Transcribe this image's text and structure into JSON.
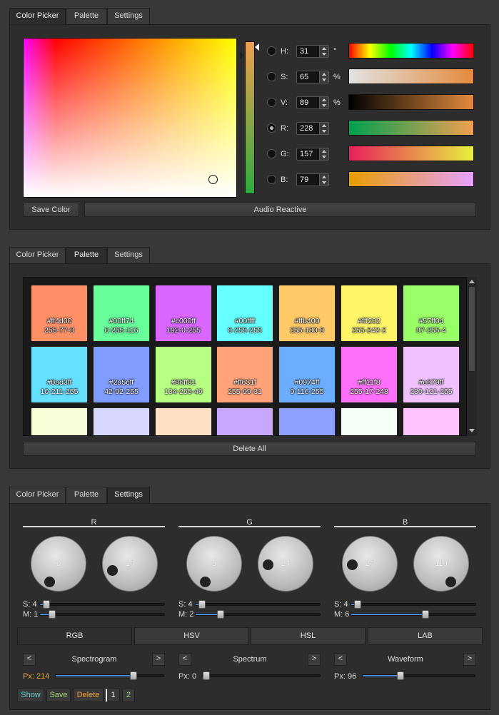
{
  "tabs_labels": [
    "Color Picker",
    "Palette",
    "Settings"
  ],
  "picker": {
    "channels": [
      {
        "label": "H:",
        "value": "31",
        "unit": "°"
      },
      {
        "label": "S:",
        "value": "65",
        "unit": "%"
      },
      {
        "label": "V:",
        "value": "89",
        "unit": "%"
      },
      {
        "label": "R:",
        "value": "228",
        "unit": ""
      },
      {
        "label": "G:",
        "value": "157",
        "unit": ""
      },
      {
        "label": "B:",
        "value": "79",
        "unit": ""
      }
    ],
    "selected_channel": "R",
    "save_label": "Save Color",
    "audio_label": "Audio Reactive"
  },
  "palette": {
    "swatches": [
      {
        "hex": "#ff4d00",
        "rgb": "255-77-0",
        "color": "#ff8f66"
      },
      {
        "hex": "#00ff74",
        "rgb": "0-255-116",
        "color": "#66ff9a"
      },
      {
        "hex": "#c000ff",
        "rgb": "192-0-255",
        "color": "#d866ff"
      },
      {
        "hex": "#00ffff",
        "rgb": "0-255-255",
        "color": "#66ffff"
      },
      {
        "hex": "#ffb400",
        "rgb": "255-180-0",
        "color": "#ffc966"
      },
      {
        "hex": "#fff202",
        "rgb": "255-242-2",
        "color": "#fff566"
      },
      {
        "hex": "#57ff04",
        "rgb": "87-255-4",
        "color": "#99ff66"
      },
      {
        "hex": "#0ad3ff",
        "rgb": "10-211-255",
        "color": "#66e0ff"
      },
      {
        "hex": "#2a5cff",
        "rgb": "42-92-255",
        "color": "#7f9dff"
      },
      {
        "hex": "#86ff31",
        "rgb": "134-255-49",
        "color": "#b6ff83"
      },
      {
        "hex": "#ff631f",
        "rgb": "255-99-31",
        "color": "#ffa179"
      },
      {
        "hex": "#0974ff",
        "rgb": "9-116-255",
        "color": "#6baeff"
      },
      {
        "hex": "#ff11f8",
        "rgb": "255-17-248",
        "color": "#ff70fa"
      },
      {
        "hex": "#e679ff",
        "rgb": "230-121-255",
        "color": "#f1c0ff"
      },
      {
        "hex": "",
        "rgb": "",
        "color": "#f8ffd8"
      },
      {
        "hex": "",
        "rgb": "",
        "color": "#d8d8ff"
      },
      {
        "hex": "",
        "rgb": "",
        "color": "#ffe0c4"
      },
      {
        "hex": "",
        "rgb": "",
        "color": "#c8a8ff"
      },
      {
        "hex": "",
        "rgb": "",
        "color": "#90a0ff"
      },
      {
        "hex": "",
        "rgb": "",
        "color": "#f4fff8"
      },
      {
        "hex": "",
        "rgb": "",
        "color": "#ffc4ff"
      }
    ],
    "delete_label": "Delete All"
  },
  "settings": {
    "groups": [
      {
        "name": "R",
        "knobs": [
          "0",
          "14"
        ],
        "s_label": "S: 4",
        "m_label": "M: 1",
        "s_level": 0.03,
        "m_level": 0.1
      },
      {
        "name": "G",
        "knobs": [
          "5",
          "24"
        ],
        "s_label": "S: 4",
        "m_label": "M: 2",
        "s_level": 0.03,
        "m_level": 0.2
      },
      {
        "name": "B",
        "knobs": [
          "24",
          "119"
        ],
        "s_label": "S: 4",
        "m_label": "M: 6",
        "s_level": 0.03,
        "m_level": 0.6
      }
    ],
    "modes": [
      "RGB",
      "HSV",
      "HSL",
      "LAB"
    ],
    "active_mode": "RGB",
    "visuals": [
      {
        "name": "Spectrogram",
        "px_label": "Px: 214",
        "level": 0.72
      },
      {
        "name": "Spectrum",
        "px_label": "Px: 0",
        "level": 0.0
      },
      {
        "name": "Waveform",
        "px_label": "Px: 96",
        "level": 0.34
      }
    ],
    "prev_arrow": "<",
    "next_arrow": ">",
    "show_label": "Show",
    "save_label": "Save",
    "delete_label": "Delete",
    "page1": "1",
    "page2": "2"
  },
  "colors": {
    "show": "#4fd3d3",
    "save": "#9bd36b",
    "delete": "#f0a030",
    "px_accent": "#e8a030",
    "slider_fill": "#4f8fd8"
  }
}
